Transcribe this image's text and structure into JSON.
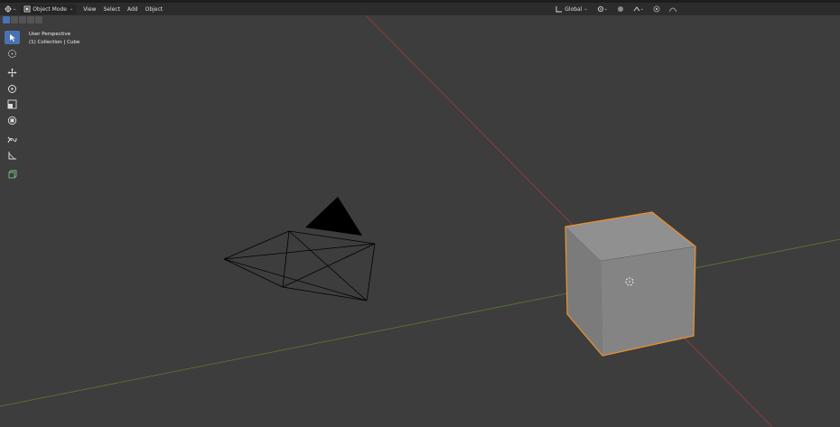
{
  "header": {
    "mode_label": "Object Mode",
    "menus": [
      "View",
      "Select",
      "Add",
      "Object"
    ],
    "orientation_label": "Global"
  },
  "overlay": {
    "view_name": "User Perspective",
    "collection_info": "(1) Collection | Cube"
  },
  "toolbar": {
    "tools": [
      "select-box",
      "cursor",
      "move",
      "rotate",
      "scale",
      "transform",
      "annotate",
      "measure",
      "add-cube"
    ],
    "active_tool": "select-box"
  },
  "scene": {
    "objects": [
      "Camera",
      "Cube"
    ],
    "selected": "Cube"
  },
  "colors": {
    "background": "#3d3d3d",
    "header": "#2c2c2c",
    "selection_outline": "#f0902a",
    "x_axis": "#a33b3b",
    "y_axis": "#5c7a2f",
    "active_tool": "#4772b3"
  }
}
